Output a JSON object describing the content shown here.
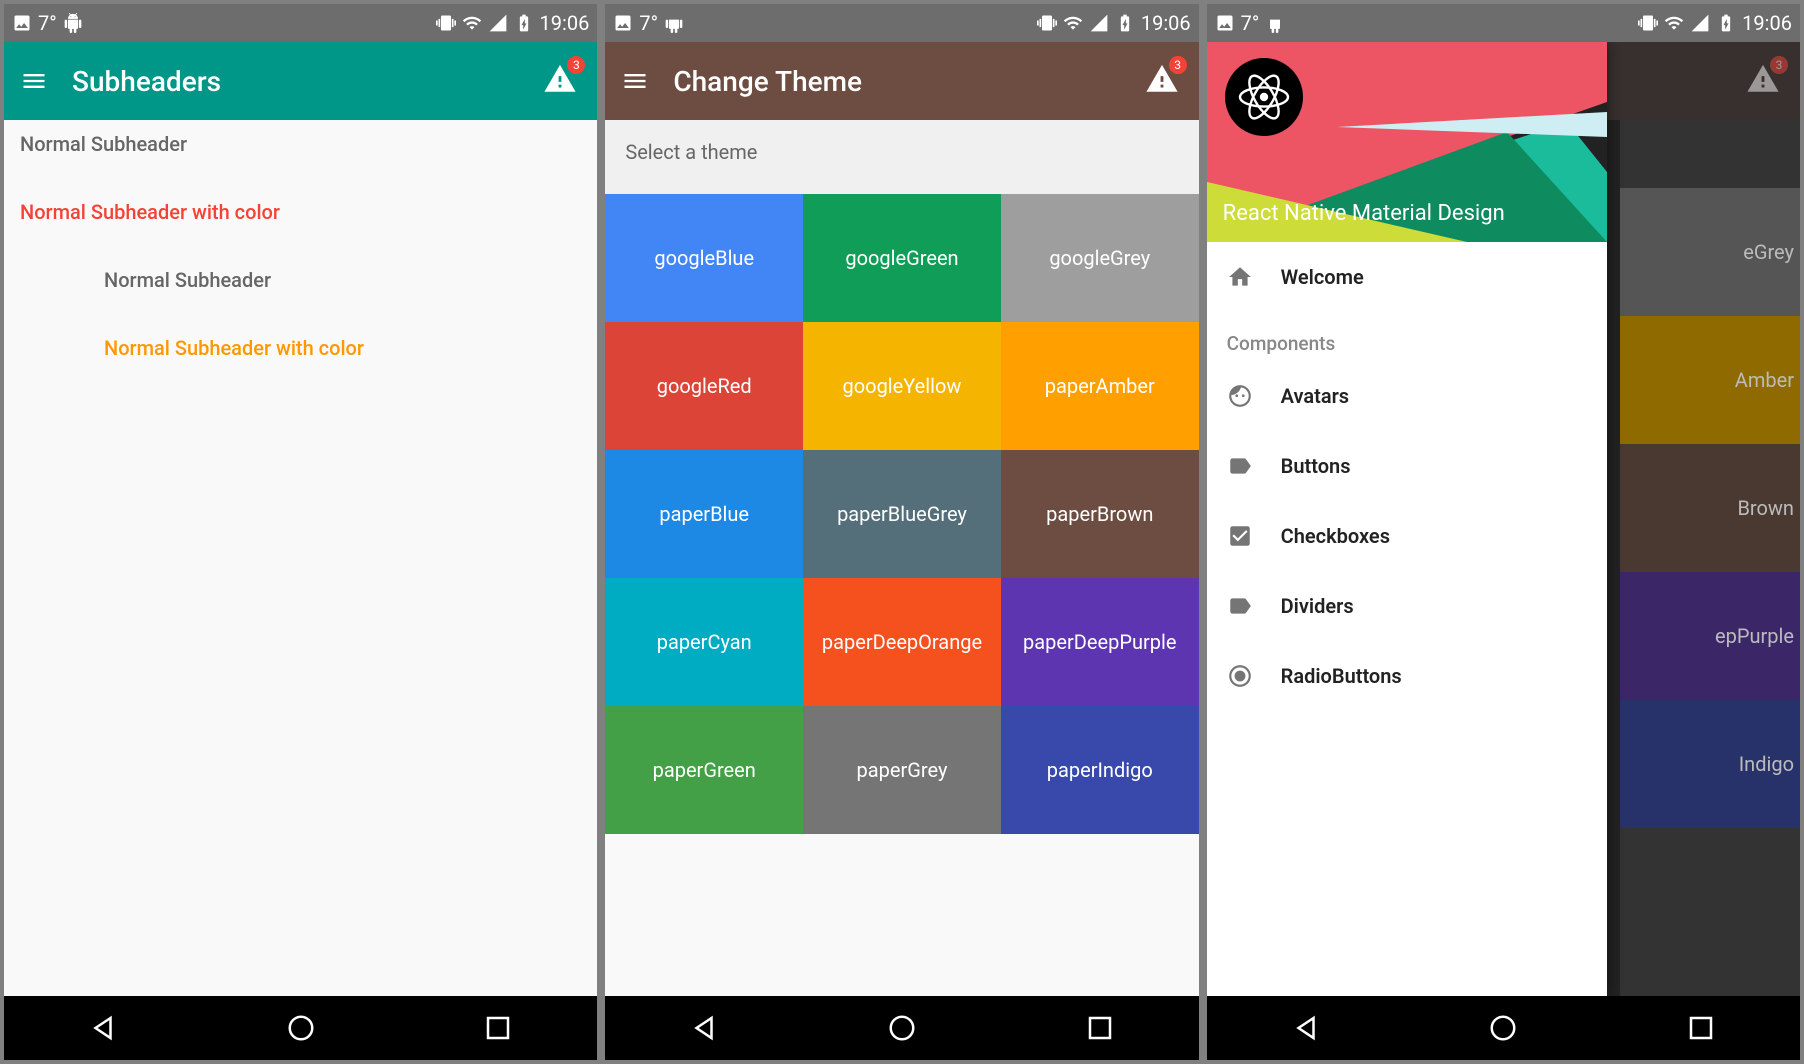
{
  "status": {
    "temp": "7°",
    "time": "19:06"
  },
  "screen1": {
    "title": "Subheaders",
    "badge": "3",
    "items": [
      {
        "label": "Normal Subheader",
        "color": "grey",
        "inset": false
      },
      {
        "label": "Normal Subheader with color",
        "color": "red",
        "inset": false
      },
      {
        "label": "Normal Subheader",
        "color": "grey",
        "inset": true
      },
      {
        "label": "Normal Subheader with color",
        "color": "orange",
        "inset": true
      }
    ]
  },
  "screen2": {
    "title": "Change Theme",
    "badge": "3",
    "selectLabel": "Select a theme",
    "themes": [
      {
        "name": "googleBlue",
        "color": "#4285F4"
      },
      {
        "name": "googleGreen",
        "color": "#0F9D58"
      },
      {
        "name": "googleGrey",
        "color": "#9E9E9E"
      },
      {
        "name": "googleRed",
        "color": "#DB4437"
      },
      {
        "name": "googleYellow",
        "color": "#F4B400"
      },
      {
        "name": "paperAmber",
        "color": "#FFA000"
      },
      {
        "name": "paperBlue",
        "color": "#1E88E5"
      },
      {
        "name": "paperBlueGrey",
        "color": "#546E7A"
      },
      {
        "name": "paperBrown",
        "color": "#6D4C41"
      },
      {
        "name": "paperCyan",
        "color": "#00ACC1"
      },
      {
        "name": "paperDeepOrange",
        "color": "#F4511E"
      },
      {
        "name": "paperDeepPurple",
        "color": "#5E35B1"
      },
      {
        "name": "paperGreen",
        "color": "#43A047"
      },
      {
        "name": "paperGrey",
        "color": "#757575"
      },
      {
        "name": "paperIndigo",
        "color": "#3949AB"
      }
    ]
  },
  "screen3": {
    "badge": "3",
    "drawerTitle": "React Native Material Design",
    "welcome": "Welcome",
    "sectionLabel": "Components",
    "items": [
      {
        "icon": "home",
        "label": "Welcome"
      },
      {
        "icon": "section",
        "label": "Components"
      },
      {
        "icon": "face",
        "label": "Avatars"
      },
      {
        "icon": "tag",
        "label": "Buttons"
      },
      {
        "icon": "checkbox",
        "label": "Checkboxes"
      },
      {
        "icon": "tag",
        "label": "Dividers"
      },
      {
        "icon": "radio",
        "label": "RadioButtons"
      }
    ],
    "behindThemes": [
      {
        "name": "eGrey",
        "color": "#555"
      },
      {
        "name": "Amber",
        "color": "#8f6a00"
      },
      {
        "name": "Brown",
        "color": "#4a3930"
      },
      {
        "name": "epPurple",
        "color": "#3b2668"
      },
      {
        "name": "Indigo",
        "color": "#27326a"
      }
    ]
  },
  "nav": {
    "back": "back",
    "home": "home",
    "recent": "recent"
  }
}
